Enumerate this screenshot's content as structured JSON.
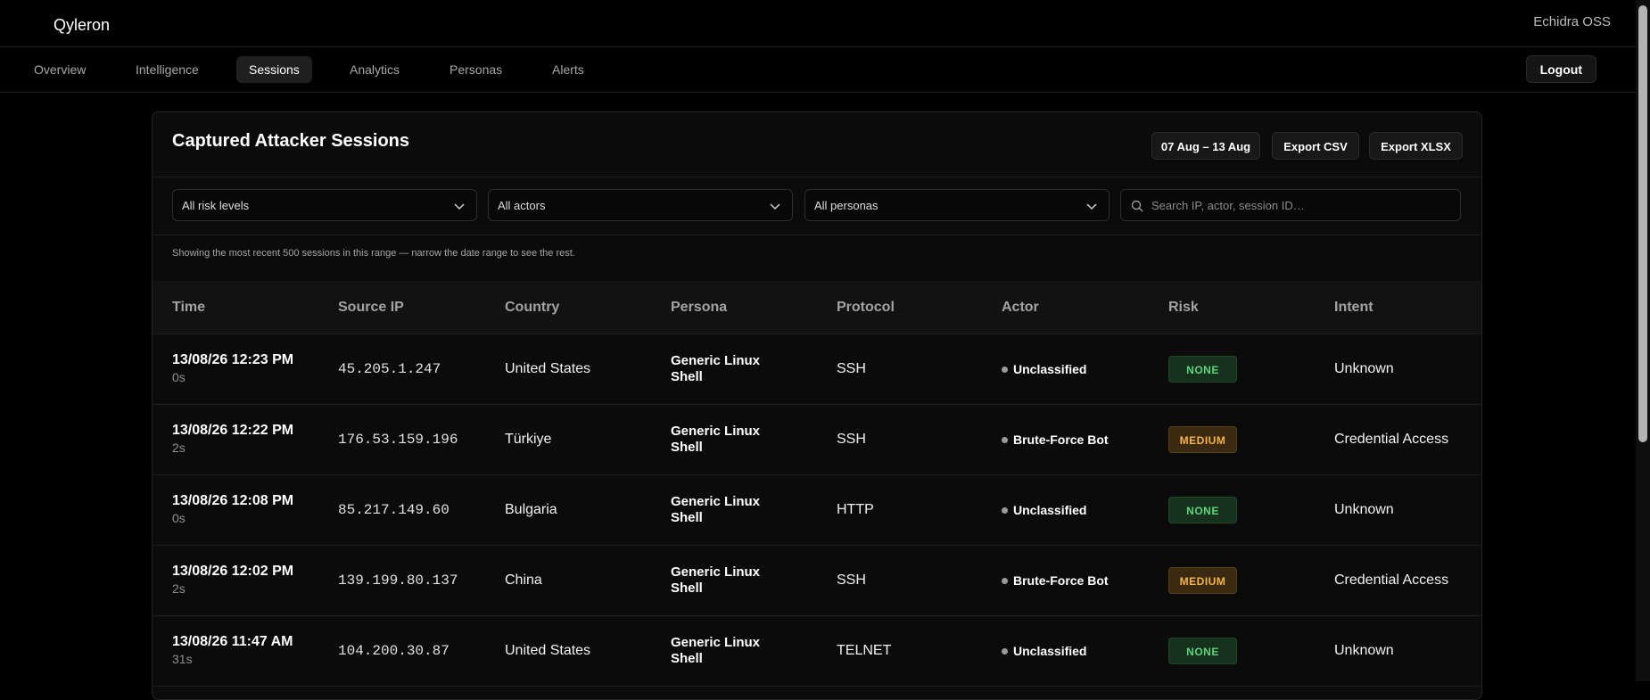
{
  "app": {
    "brand": "Qyleron",
    "org": "Echidra OSS"
  },
  "nav": {
    "tabs": [
      {
        "label": "Overview"
      },
      {
        "label": "Intelligence"
      },
      {
        "label": "Sessions"
      },
      {
        "label": "Analytics"
      },
      {
        "label": "Personas"
      },
      {
        "label": "Alerts"
      }
    ],
    "active": "Sessions",
    "logout_label": "Logout"
  },
  "panel": {
    "title": "Captured Attacker Sessions",
    "date_range_label": "07 Aug – 13 Aug",
    "export_csv_label": "Export CSV",
    "export_xlsx_label": "Export XLSX"
  },
  "filters": {
    "risk": "All risk levels",
    "actor": "All actors",
    "persona": "All personas",
    "search_placeholder": "Search IP, actor, session ID…"
  },
  "notice": "Showing the most recent 500 sessions in this range — narrow the date range to see the rest.",
  "table": {
    "headers": {
      "time": "Time",
      "source_ip": "Source IP",
      "country": "Country",
      "persona": "Persona",
      "protocol": "Protocol",
      "actor": "Actor",
      "risk": "Risk",
      "intent": "Intent"
    },
    "rows": [
      {
        "time": "13/08/26 12:23 PM",
        "duration": "0s",
        "ip": "45.205.1.247",
        "country": "United States",
        "persona": "Generic Linux Shell",
        "protocol": "SSH",
        "actor": "Unclassified",
        "risk": "NONE",
        "intent": "Unknown"
      },
      {
        "time": "13/08/26 12:22 PM",
        "duration": "2s",
        "ip": "176.53.159.196",
        "country": "Türkiye",
        "persona": "Generic Linux Shell",
        "protocol": "SSH",
        "actor": "Brute-Force Bot",
        "risk": "MEDIUM",
        "intent": "Credential Access"
      },
      {
        "time": "13/08/26 12:08 PM",
        "duration": "0s",
        "ip": "85.217.149.60",
        "country": "Bulgaria",
        "persona": "Generic Linux Shell",
        "protocol": "HTTP",
        "actor": "Unclassified",
        "risk": "NONE",
        "intent": "Unknown"
      },
      {
        "time": "13/08/26 12:02 PM",
        "duration": "2s",
        "ip": "139.199.80.137",
        "country": "China",
        "persona": "Generic Linux Shell",
        "protocol": "SSH",
        "actor": "Brute-Force Bot",
        "risk": "MEDIUM",
        "intent": "Credential Access"
      },
      {
        "time": "13/08/26 11:47 AM",
        "duration": "31s",
        "ip": "104.200.30.87",
        "country": "United States",
        "persona": "Generic Linux Shell",
        "protocol": "TELNET",
        "actor": "Unclassified",
        "risk": "NONE",
        "intent": "Unknown"
      }
    ]
  },
  "colors": {
    "risk_none_fg": "#5fd37e",
    "risk_none_bg": "#16321d",
    "risk_medium_fg": "#f4b44a",
    "risk_medium_bg": "#3a2a12"
  }
}
